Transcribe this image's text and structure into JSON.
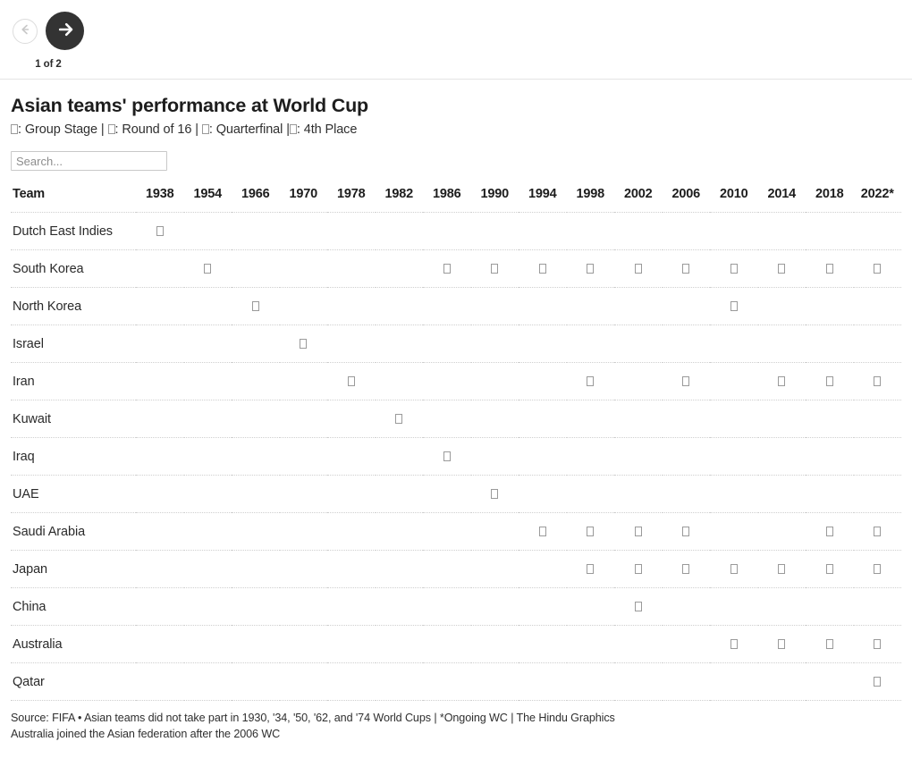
{
  "nav": {
    "prev_label": "Previous page",
    "prev_icon": "arrow-left-icon",
    "next_label": "Next page",
    "next_icon": "arrow-right-icon",
    "page_indicator": "1 of 2",
    "prev_enabled": false,
    "next_enabled": true,
    "prev_color": "#c8c8c8",
    "next_bg": "#333333",
    "next_arrow_color": "#ffffff"
  },
  "header": {
    "title": "Asian teams' performance at World Cup",
    "legend_text": ": Group Stage | : Round of 16 | : Quarterfinal |: 4th Place",
    "legend_items": [
      {
        "marker": "missing-glyph",
        "label": ": Group Stage"
      },
      {
        "marker": "missing-glyph",
        "label": ": Round of 16"
      },
      {
        "marker": "missing-glyph",
        "label": ": Quarterfinal"
      },
      {
        "marker": "missing-glyph",
        "label": ": 4th Place"
      }
    ],
    "separator": "|"
  },
  "search": {
    "placeholder": "Search...",
    "value": ""
  },
  "chart_data": {
    "type": "table",
    "title": "Asian teams' performance at World Cup",
    "columns": [
      "Team",
      "1938",
      "1954",
      "1966",
      "1970",
      "1978",
      "1982",
      "1986",
      "1990",
      "1994",
      "1998",
      "2002",
      "2006",
      "2010",
      "2014",
      "2018",
      "2022*"
    ],
    "years": [
      "1938",
      "1954",
      "1966",
      "1970",
      "1978",
      "1982",
      "1986",
      "1990",
      "1994",
      "1998",
      "2002",
      "2006",
      "2010",
      "2014",
      "2018",
      "2022*"
    ],
    "cell_marker": "missing-glyph",
    "rows": [
      {
        "team": "Dutch East Indies",
        "cells": [
          "□",
          "",
          "",
          "",
          "",
          "",
          "",
          "",
          "",
          "",
          "",
          "",
          "",
          "",
          "",
          ""
        ]
      },
      {
        "team": "South Korea",
        "cells": [
          "",
          "□",
          "",
          "",
          "",
          "",
          "□",
          "□",
          "□",
          "□",
          "□",
          "□",
          "□",
          "□",
          "□",
          "□"
        ]
      },
      {
        "team": "North Korea",
        "cells": [
          "",
          "",
          "□",
          "",
          "",
          "",
          "",
          "",
          "",
          "",
          "",
          "",
          "□",
          "",
          "",
          ""
        ]
      },
      {
        "team": "Israel",
        "cells": [
          "",
          "",
          "",
          "□",
          "",
          "",
          "",
          "",
          "",
          "",
          "",
          "",
          "",
          "",
          "",
          ""
        ]
      },
      {
        "team": "Iran",
        "cells": [
          "",
          "",
          "",
          "",
          "□",
          "",
          "",
          "",
          "",
          "□",
          "",
          "□",
          "",
          "□",
          "□",
          "□"
        ]
      },
      {
        "team": "Kuwait",
        "cells": [
          "",
          "",
          "",
          "",
          "",
          "□",
          "",
          "",
          "",
          "",
          "",
          "",
          "",
          "",
          "",
          ""
        ]
      },
      {
        "team": "Iraq",
        "cells": [
          "",
          "",
          "",
          "",
          "",
          "",
          "□",
          "",
          "",
          "",
          "",
          "",
          "",
          "",
          "",
          ""
        ]
      },
      {
        "team": "UAE",
        "cells": [
          "",
          "",
          "",
          "",
          "",
          "",
          "",
          "□",
          "",
          "",
          "",
          "",
          "",
          "",
          "",
          ""
        ]
      },
      {
        "team": "Saudi Arabia",
        "cells": [
          "",
          "",
          "",
          "",
          "",
          "",
          "",
          "",
          "□",
          "□",
          "□",
          "□",
          "",
          "",
          "□",
          "□"
        ]
      },
      {
        "team": "Japan",
        "cells": [
          "",
          "",
          "",
          "",
          "",
          "",
          "",
          "",
          "",
          "□",
          "□",
          "□",
          "□",
          "□",
          "□",
          "□"
        ]
      },
      {
        "team": "China",
        "cells": [
          "",
          "",
          "",
          "",
          "",
          "",
          "",
          "",
          "",
          "",
          "□",
          "",
          "",
          "",
          "",
          ""
        ]
      },
      {
        "team": "Australia",
        "cells": [
          "",
          "",
          "",
          "",
          "",
          "",
          "",
          "",
          "",
          "",
          "",
          "",
          "□",
          "□",
          "□",
          "□"
        ]
      },
      {
        "team": "Qatar",
        "cells": [
          "",
          "",
          "",
          "",
          "",
          "",
          "",
          "",
          "",
          "",
          "",
          "",
          "",
          "",
          "",
          "□"
        ]
      }
    ]
  },
  "footer": {
    "line1": "Source: FIFA • Asian teams did not take part in 1930, '34, '50, '62, and '74 World Cups | *Ongoing WC | The Hindu Graphics",
    "line2": "Australia joined the Asian federation after the 2006 WC"
  }
}
